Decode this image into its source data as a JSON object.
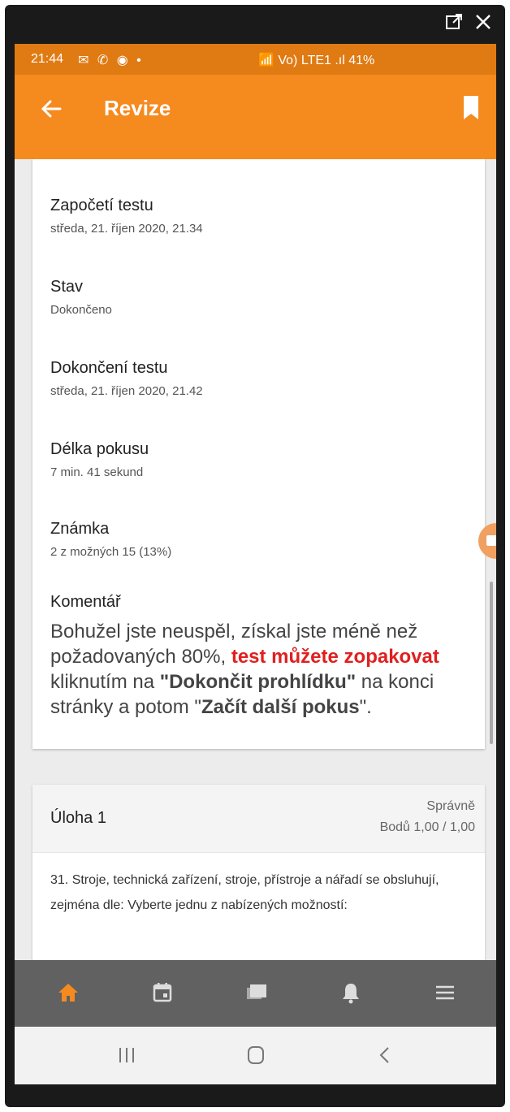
{
  "window_controls": {
    "popout_icon": "external-window-icon",
    "close_icon": "close-icon"
  },
  "status_bar": {
    "time": "21:44",
    "icons": "✉ ✆ ◉ •",
    "right": "📶 Vo) LTE1 .ıl 41%"
  },
  "app_bar": {
    "title": "Revize",
    "back_icon": "arrow-back-icon",
    "bookmark_icon": "bookmark-icon"
  },
  "summary": {
    "started_label": "Započetí testu",
    "started_value": "středa, 21. říjen 2020, 21.34",
    "state_label": "Stav",
    "state_value": "Dokončeno",
    "finished_label": "Dokončení testu",
    "finished_value": "středa, 21. říjen 2020, 21.42",
    "duration_label": "Délka pokusu",
    "duration_value": "7 min. 41 sekund",
    "grade_label": "Známka",
    "grade_value": "2 z možných 15 (13%)",
    "comment_label": "Komentář",
    "comment_part1": "Bohužel jste neuspěl, získal jste méně než požadovaných 80%, ",
    "comment_part2": "test můžete zopakovat",
    "comment_part3": " kliknutím na ",
    "comment_part4": "\"Dokončit prohlídku\"",
    "comment_part5": " na konci stránky a potom \"",
    "comment_part6": "Začít další pokus",
    "comment_part7": "\".",
    "accent_red": "#e02020"
  },
  "question": {
    "name": "Úloha 1",
    "state": "Správně",
    "points": "Bodů 1,00 / 1,00",
    "text": "31. Stroje, technická zařízení, stroje, přístroje a nářadí se obsluhují, zejména dle: Vyberte jednu z nabízených možností:"
  },
  "bottom_nav": [
    "home-icon",
    "calendar-icon",
    "messages-icon",
    "notifications-icon",
    "menu-icon"
  ],
  "system_nav": [
    "recent-apps-icon",
    "home-circle-icon",
    "back-chevron-icon"
  ],
  "colors": {
    "status": "#e07a12",
    "app_bar": "#f58a1f",
    "nav_bg": "#616161",
    "active": "#f58a1f"
  }
}
